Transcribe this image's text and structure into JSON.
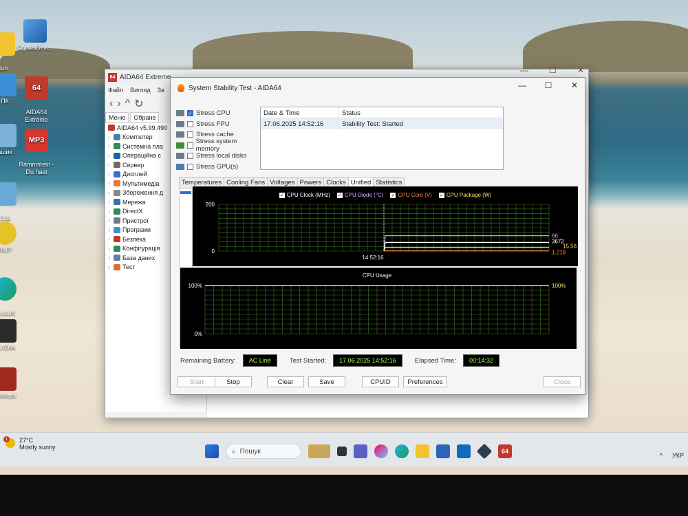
{
  "desktop": {
    "icons": [
      {
        "label": "CrystalDisk...",
        "badge": ""
      },
      {
        "label": "AIDA64\nExtreme",
        "badge": "64"
      },
      {
        "label": "Rammstein -\nDu hast",
        "badge": "MP3"
      },
      {
        "label": "tun\ning",
        "badge": ""
      },
      {
        "label": "ПК",
        "badge": ""
      },
      {
        "label": "ашик",
        "badge": ""
      },
      {
        "label": "Ссв\nважня",
        "badge": ""
      },
      {
        "label": "AMP",
        "badge": ""
      },
      {
        "label": "icrosoft\nEdge",
        "badge": ""
      },
      {
        "label": "NVIDIA",
        "badge": ""
      },
      {
        "label": "FurMark",
        "badge": ""
      }
    ]
  },
  "aida_main": {
    "title": "AIDA64 Extreme",
    "logo": "64",
    "menu": [
      "Файл",
      "Вигляд",
      "Зв"
    ],
    "tabs": [
      "Меню",
      "Обране"
    ],
    "tree_root": "AIDA64 v5.99.490",
    "tree": [
      "Комп'ютер",
      "Системна пла",
      "Операційна с",
      "Сервер",
      "Дисплей",
      "Мультимедіа",
      "Збереження д",
      "Мережа",
      "DirectX",
      "Пристрої",
      "Програми",
      "Безпека",
      "Конфігурація",
      "База даних",
      "Тест"
    ]
  },
  "sst": {
    "title": "System Stability Test - AIDA64",
    "window_controls": {
      "minimize": "—",
      "maximize": "☐",
      "close": "✕"
    },
    "stress_options": [
      {
        "label": "Stress CPU",
        "checked": true
      },
      {
        "label": "Stress FPU",
        "checked": false
      },
      {
        "label": "Stress cache",
        "checked": false
      },
      {
        "label": "Stress system memory",
        "checked": false
      },
      {
        "label": "Stress local disks",
        "checked": false
      },
      {
        "label": "Stress GPU(s)",
        "checked": false
      }
    ],
    "status_table": {
      "headers": [
        "Date & Time",
        "Status"
      ],
      "rows": [
        {
          "datetime": "17.06.2025 14:52:16",
          "status": "Stability Test: Started"
        }
      ]
    },
    "tabs": [
      {
        "label": "Temperatures",
        "active": false
      },
      {
        "label": "Cooling Fans",
        "active": false
      },
      {
        "label": "Voltages",
        "active": false
      },
      {
        "label": "Powers",
        "active": false
      },
      {
        "label": "Clocks",
        "active": false
      },
      {
        "label": "Unified",
        "active": true
      },
      {
        "label": "Statistics",
        "active": false
      }
    ],
    "bottom": {
      "battery_label": "Remaining Battery:",
      "battery_value": "AC Line",
      "started_label": "Test Started:",
      "started_value": "17.06.2025 14:52:16",
      "elapsed_label": "Elapsed Time:",
      "elapsed_value": "00:14:32"
    },
    "buttons": {
      "start": "Start",
      "stop": "Stop",
      "clear": "Clear",
      "save": "Save",
      "cpuid": "CPUID",
      "preferences": "Preferences",
      "close": "Close"
    }
  },
  "chart_data": [
    {
      "type": "line",
      "title": "",
      "legend": [
        {
          "name": "CPU Clock (MHz)",
          "color": "#ffffff",
          "checked": true
        },
        {
          "name": "CPU Diode (°C)",
          "color": "#d9a4ff",
          "checked": true
        },
        {
          "name": "CPU Core (V)",
          "color": "#ff8c42",
          "checked": true
        },
        {
          "name": "CPU Package (W)",
          "color": "#ffe066",
          "checked": true
        }
      ],
      "ylim": [
        0,
        200
      ],
      "ytick_labels": [
        "200",
        "0"
      ],
      "xtick_label": "14:52:16",
      "marker_fraction": 0.5,
      "readouts": [
        {
          "series": "CPU Diode (°C)",
          "text": "66",
          "value": 66,
          "color": "#d9a4ff"
        },
        {
          "series": "CPU Clock (MHz)",
          "text": "3672",
          "value": 36.7,
          "color": "#ffffff"
        },
        {
          "series": "CPU Package (W)",
          "text": "15.56",
          "value": 15.56,
          "color": "#ffe066"
        },
        {
          "series": "CPU Core (V)",
          "text": "1.219",
          "value": 1.2,
          "color": "#ff8c42"
        }
      ],
      "grid": true
    },
    {
      "type": "line",
      "title": "CPU Usage",
      "ylim": [
        0,
        100
      ],
      "ytick_labels": [
        "100%",
        "0%"
      ],
      "series": [
        {
          "name": "CPU Usage",
          "value": 100,
          "color": "#ffe066"
        }
      ],
      "readout": "100%",
      "grid": true
    }
  ],
  "taskbar": {
    "weather_temp": "27°C",
    "weather_desc": "Mostly sunny",
    "weather_badge": "1",
    "search_placeholder": "Пошук",
    "tray_lang": "УКР",
    "tray_arrow": "^"
  }
}
